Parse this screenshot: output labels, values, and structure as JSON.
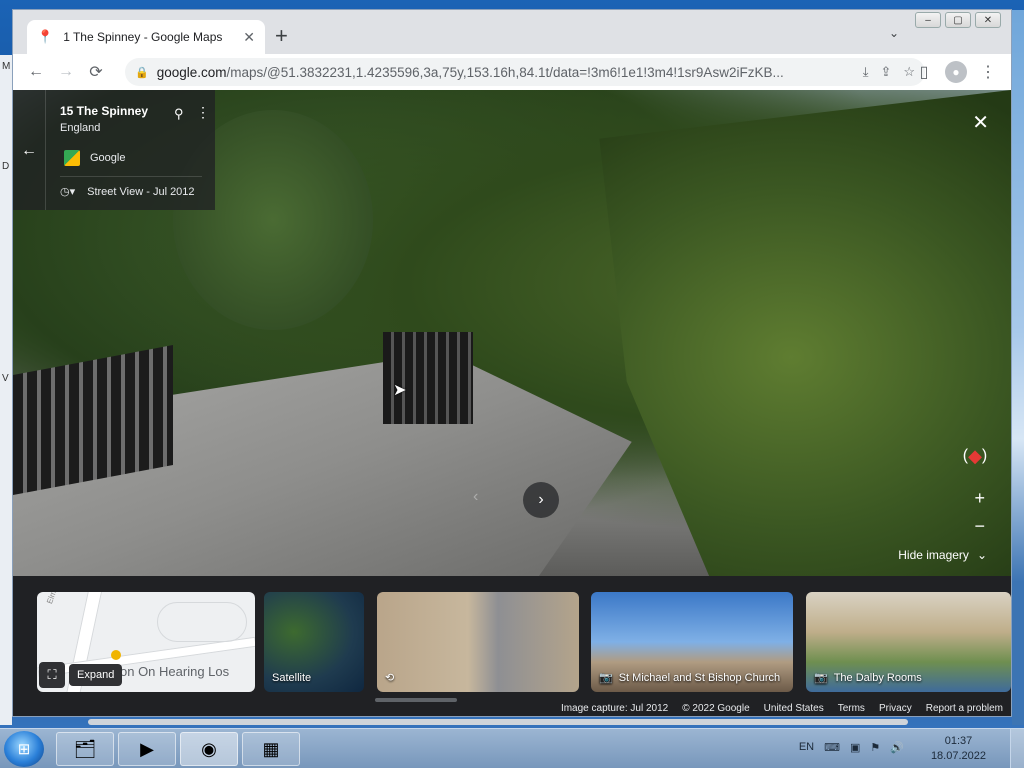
{
  "browser": {
    "tab_title": "1 The Spinney - Google Maps",
    "tab_close": "✕",
    "new_tab": "+",
    "url_host": "google.com",
    "url_path": "/maps/@51.3832231,1.4235596,3a,75y,153.16h,84.1t/data=!3m6!1e1!3m4!1sr9Asw2iFzKB...",
    "window_controls": [
      "–",
      "▢",
      "✕"
    ]
  },
  "street_view": {
    "place_title": "15 The Spinney",
    "place_subtitle": "England",
    "provider": "Google",
    "capture_label": "Street View - Jul 2012",
    "hide_imagery": "Hide imagery",
    "close_glyph": "✕",
    "zoom_in": "+",
    "zoom_out": "−"
  },
  "imagery_strip": {
    "map_text": "ction On Hearing Los",
    "map_street": "Elmstone Gard",
    "expand_label": "Expand",
    "satellite_label": "Satellite",
    "church_label": "St Michael and St Bishop Church",
    "dalby_label": "The Dalby Rooms"
  },
  "footer": {
    "items": [
      "Image capture: Jul 2012",
      "© 2022 Google",
      "United States",
      "Terms",
      "Privacy",
      "Report a problem"
    ]
  },
  "taskbar": {
    "language": "EN",
    "time": "01:37",
    "date": "18.07.2022"
  },
  "colors": {
    "accent_red": "#e53935",
    "dark_panel": "#202124"
  }
}
